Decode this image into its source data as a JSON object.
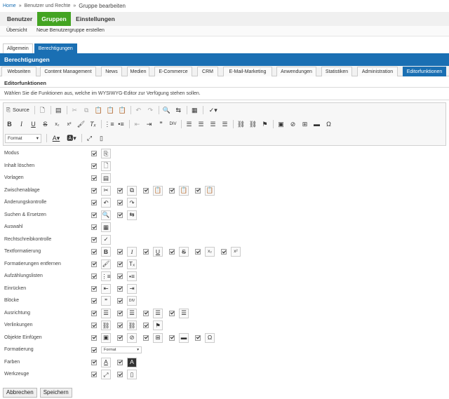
{
  "breadcrumb": {
    "home": "Home",
    "sep": "»",
    "parent": "Benutzer und Rechte",
    "current": "Gruppe bearbeiten"
  },
  "main_nav": [
    "Benutzer",
    "Gruppen",
    "Einstellungen"
  ],
  "sub_nav": [
    "Übersicht",
    "Neue Benutzergruppe erstellen"
  ],
  "tabs": [
    "Allgemein",
    "Berechtigungen"
  ],
  "section_title": "Berechtigungen",
  "perm_tabs": [
    "Webseiten",
    "Content Management",
    "News",
    "Medien",
    "E-Commerce",
    "CRM",
    "E-Mail-Marketing",
    "Anwendungen",
    "Statistiken",
    "Administration",
    "Editorfunktionen"
  ],
  "editor_heading": "Editorfunktionen",
  "description": "Wählen Sie die Funktionen aus, welche im WYSIWYG-Editor zur Verfügung stehen sollen.",
  "toolbar": {
    "source_label": "Source",
    "format_label": "Format"
  },
  "rows": [
    {
      "label": "Modus",
      "icons": [
        "source-icon"
      ]
    },
    {
      "label": "Inhalt löschen",
      "icons": [
        "new-page-icon"
      ]
    },
    {
      "label": "Vorlagen",
      "icons": [
        "templates-icon"
      ]
    },
    {
      "label": "Zwischenablage",
      "icons": [
        "cut-icon",
        "copy-icon",
        "paste-icon",
        "paste-text-icon",
        "paste-word-icon"
      ]
    },
    {
      "label": "Änderungskontrolle",
      "icons": [
        "undo-icon",
        "redo-icon"
      ]
    },
    {
      "label": "Suchen & Ersetzen",
      "icons": [
        "find-icon",
        "replace-icon"
      ]
    },
    {
      "label": "Auswahl",
      "icons": [
        "select-all-icon"
      ]
    },
    {
      "label": "Rechtschreibkontrolle",
      "icons": [
        "spellcheck-icon"
      ]
    },
    {
      "label": "Textformatierung",
      "icons": [
        "bold-icon",
        "italic-icon",
        "underline-icon",
        "strike-icon",
        "subscript-icon",
        "superscript-icon"
      ]
    },
    {
      "label": "Formatierungen entfernen",
      "icons": [
        "copy-format-icon",
        "remove-format-icon"
      ]
    },
    {
      "label": "Aufzählungslisten",
      "icons": [
        "numbered-list-icon",
        "bulleted-list-icon"
      ]
    },
    {
      "label": "Einrücken",
      "icons": [
        "outdent-icon",
        "indent-icon"
      ]
    },
    {
      "label": "Blöcke",
      "icons": [
        "blockquote-icon",
        "creatediv-icon"
      ]
    },
    {
      "label": "Ausrichtung",
      "icons": [
        "align-left-icon",
        "align-center-icon",
        "align-right-icon",
        "justify-icon"
      ]
    },
    {
      "label": "Verlinkungen",
      "icons": [
        "link-icon",
        "unlink-icon",
        "anchor-icon"
      ]
    },
    {
      "label": "Objekte Einfügen",
      "icons": [
        "image-icon",
        "flash-icon",
        "table-icon",
        "horizontal-rule-icon",
        "special-char-icon"
      ]
    },
    {
      "label": "Formatierung",
      "icons": [],
      "select": "Format"
    },
    {
      "label": "Farben",
      "icons": [
        "text-color-icon",
        "bg-color-icon"
      ]
    },
    {
      "label": "Werkzeuge",
      "icons": [
        "maximize-icon",
        "show-blocks-icon"
      ]
    }
  ],
  "buttons": {
    "cancel": "Abbrechen",
    "save": "Speichern"
  },
  "colors": {
    "green": "#43a422",
    "blue": "#1a6fb3"
  }
}
